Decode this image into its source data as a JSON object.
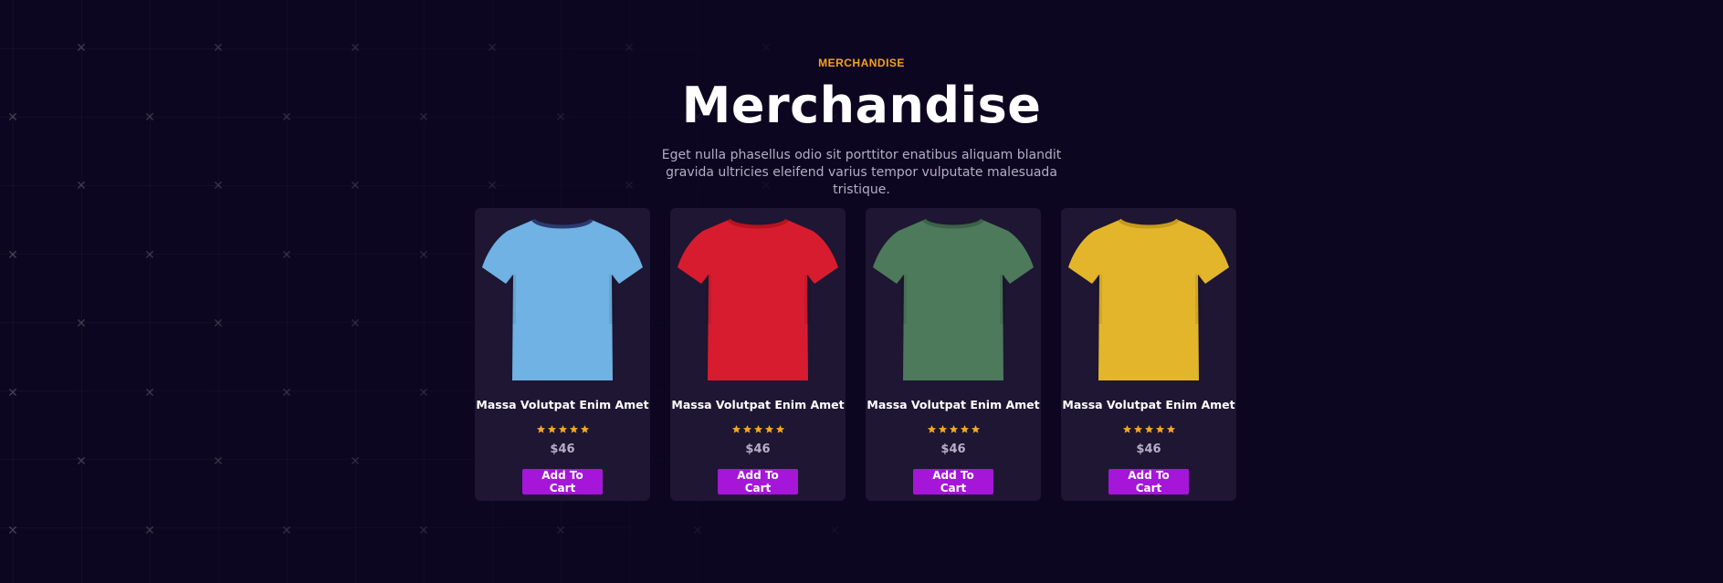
{
  "header": {
    "eyebrow": "MERCHANDISE",
    "title": "Merchandise",
    "description": "Eget nulla phasellus odio sit porttitor enatibus aliquam blandit gravida ultricies eleifend varius tempor vulputate malesuada tristique."
  },
  "products": [
    {
      "title": "Massa Volutpat Enim Amet",
      "price": "$46",
      "rating": 5,
      "button": "Add To Cart",
      "color": "#6fb2e3",
      "collar": "#2c3a72"
    },
    {
      "title": "Massa Volutpat Enim Amet",
      "price": "$46",
      "rating": 5,
      "button": "Add To Cart",
      "color": "#d81c2f",
      "collar": "#b7121f"
    },
    {
      "title": "Massa Volutpat Enim Amet",
      "price": "$46",
      "rating": 5,
      "button": "Add To Cart",
      "color": "#4c7a5a",
      "collar": "#3c6248"
    },
    {
      "title": "Massa Volutpat Enim Amet",
      "price": "$46",
      "rating": 5,
      "button": "Add To Cart",
      "color": "#e3b52b",
      "collar": "#c79a1d"
    }
  ],
  "colors": {
    "background": "#0d0620",
    "card": "#1e1632",
    "accent": "#a516d9",
    "eyebrow": "#f7a21b",
    "star": "#f5a623"
  },
  "icons": {
    "star": "star-icon",
    "shirt": "tshirt-image",
    "grid": "cross-icon"
  }
}
